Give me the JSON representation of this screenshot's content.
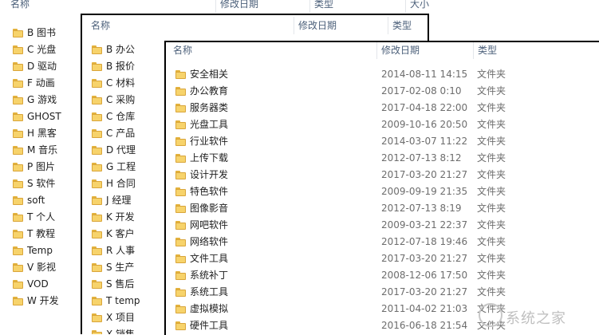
{
  "window1": {
    "columns": {
      "name": "名称",
      "modified": "修改日期",
      "type": "类型",
      "size": "大小"
    },
    "items": [
      "B 图书",
      "C 光盘",
      "D 驱动",
      "F 动画",
      "G 游戏",
      "GHOST",
      "H 黑客",
      "M 音乐",
      "P 图片",
      "S 软件",
      "soft",
      "T 个人",
      "T 教程",
      "Temp",
      "V 影视",
      "VOD",
      "W 开发"
    ]
  },
  "window2": {
    "columns": {
      "name": "名称",
      "modified": "修改日期",
      "type": "类型"
    },
    "items": [
      "B 办公",
      "B 报价",
      "C 材料",
      "C 采购",
      "C 仓库",
      "C 产品",
      "D 代理",
      "G 工程",
      "H 合同",
      "J 经理",
      "K 开发",
      "K 客户",
      "R 人事",
      "S 生产",
      "S 售后",
      "T temp",
      "X 项目",
      "X 销售"
    ]
  },
  "window3": {
    "columns": {
      "name": "名称",
      "modified": "修改日期",
      "type": "类型"
    },
    "items": [
      {
        "name": "安全相关",
        "modified": "2014-08-11 14:15",
        "type": "文件夹"
      },
      {
        "name": "办公教育",
        "modified": "2017-02-08 0:10",
        "type": "文件夹"
      },
      {
        "name": "服务器类",
        "modified": "2017-04-18 22:00",
        "type": "文件夹"
      },
      {
        "name": "光盘工具",
        "modified": "2009-10-16 20:50",
        "type": "文件夹"
      },
      {
        "name": "行业软件",
        "modified": "2014-03-07 11:22",
        "type": "文件夹"
      },
      {
        "name": "上传下载",
        "modified": "2012-07-13 8:12",
        "type": "文件夹"
      },
      {
        "name": "设计开发",
        "modified": "2017-03-20 21:27",
        "type": "文件夹"
      },
      {
        "name": "特色软件",
        "modified": "2009-09-19 21:35",
        "type": "文件夹"
      },
      {
        "name": "图像影音",
        "modified": "2012-07-13 8:19",
        "type": "文件夹"
      },
      {
        "name": "网吧软件",
        "modified": "2009-03-21 22:37",
        "type": "文件夹"
      },
      {
        "name": "网络软件",
        "modified": "2012-07-18 19:46",
        "type": "文件夹"
      },
      {
        "name": "文件工具",
        "modified": "2017-03-20 21:27",
        "type": "文件夹"
      },
      {
        "name": "系统补丁",
        "modified": "2008-12-06 17:50",
        "type": "文件夹"
      },
      {
        "name": "系统工具",
        "modified": "2017-03-20 21:27",
        "type": "文件夹"
      },
      {
        "name": "虚拟模拟",
        "modified": "2011-04-02 21:03",
        "type": "文件夹"
      },
      {
        "name": "硬件工具",
        "modified": "2016-06-18 21:54",
        "type": "文件夹"
      }
    ]
  },
  "watermark": {
    "text": "系统之家",
    "icon": "watermark-logo-icon"
  },
  "colors": {
    "folder": "#f7d36b",
    "folder_border": "#d9a53a",
    "header_text": "#4c607a",
    "meta_text": "#6d6d6d"
  }
}
